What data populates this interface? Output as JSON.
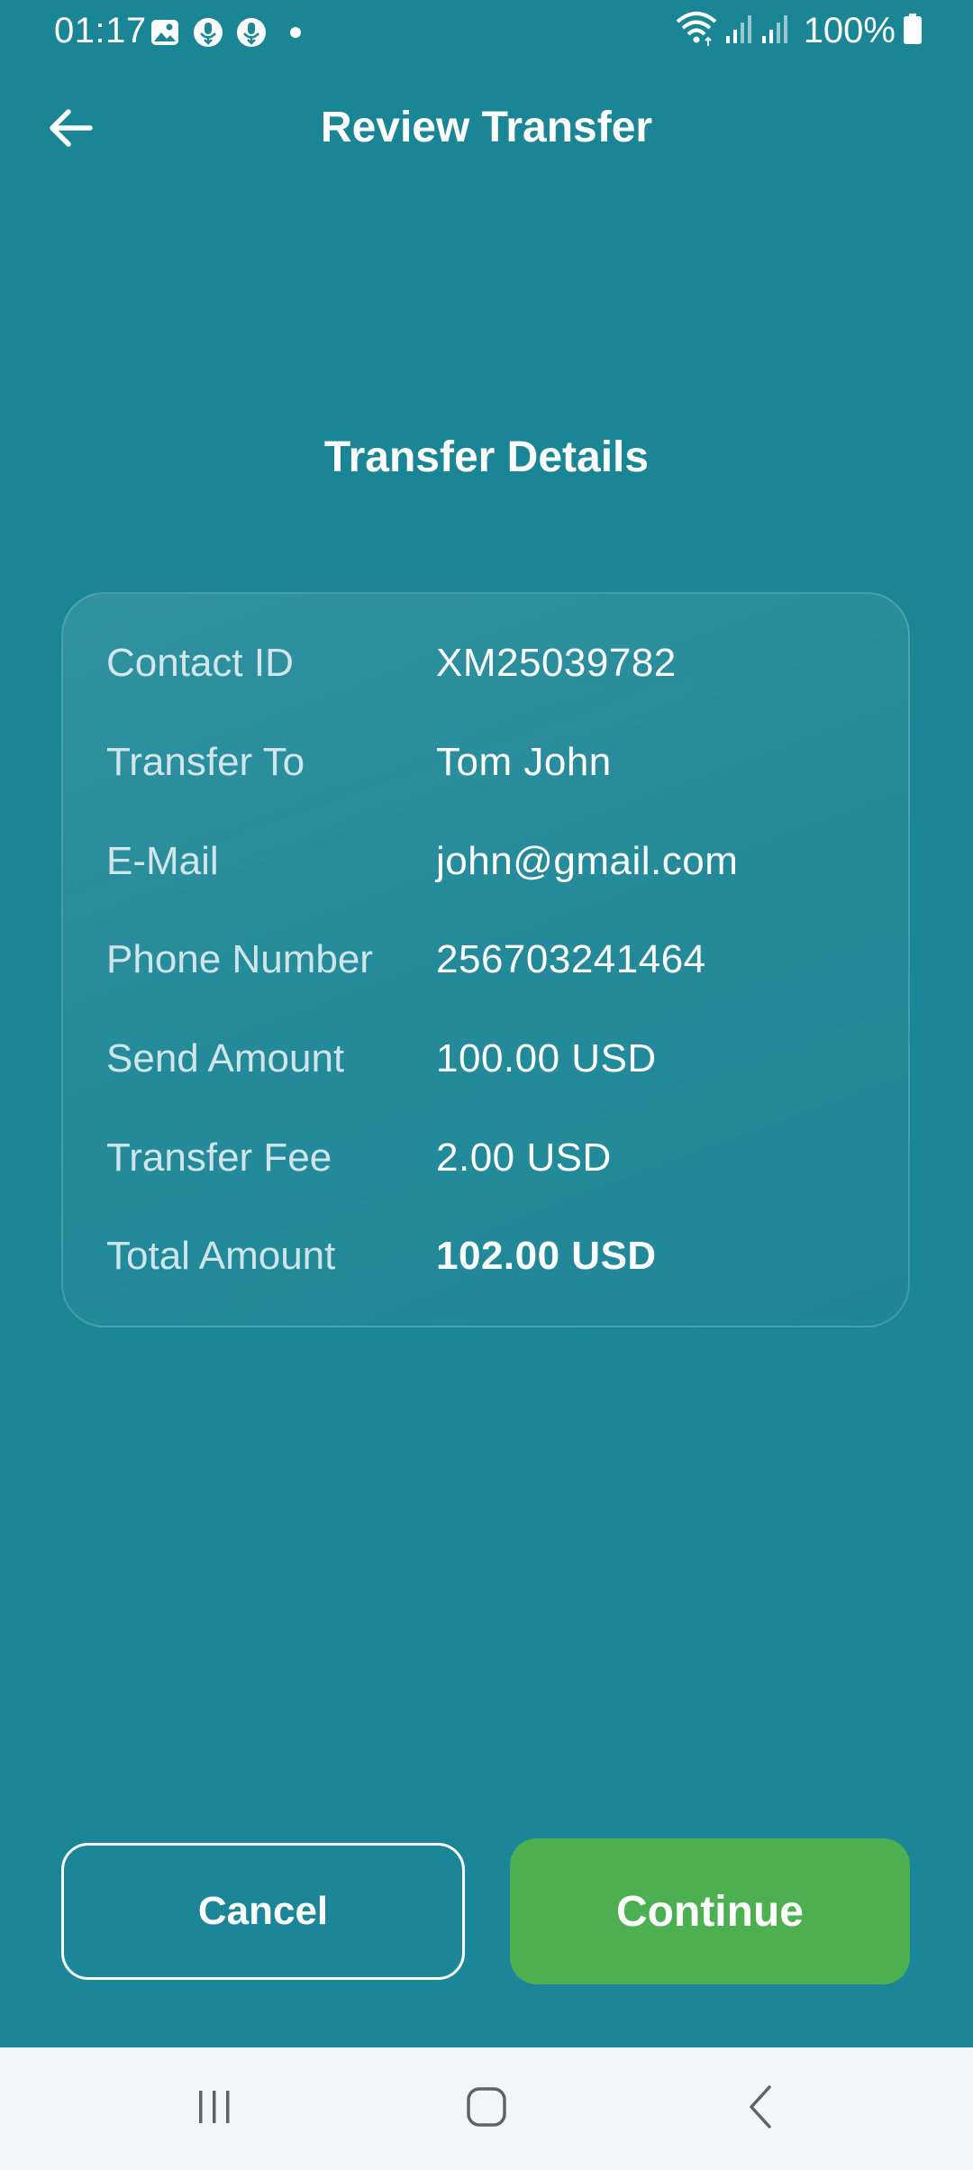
{
  "status_bar": {
    "time": "01:17",
    "battery": "100%",
    "icons": [
      "gallery-icon",
      "mic-download-icon",
      "mic-download-icon",
      "notification-dot",
      "wifi-icon",
      "signal-icon",
      "signal-icon",
      "battery-icon"
    ]
  },
  "header": {
    "title": "Review Transfer",
    "back_icon": "arrow-left-icon"
  },
  "section": {
    "title": "Transfer Details"
  },
  "details": [
    {
      "label": "Contact ID",
      "value": "XM25039782",
      "emphasis": false
    },
    {
      "label": "Transfer To",
      "value": "Tom John",
      "emphasis": false
    },
    {
      "label": "E-Mail",
      "value": "john@gmail.com",
      "emphasis": false
    },
    {
      "label": "Phone Number",
      "value": "256703241464",
      "emphasis": false
    },
    {
      "label": "Send Amount",
      "value": "100.00 USD",
      "emphasis": false
    },
    {
      "label": "Transfer Fee",
      "value": "2.00 USD",
      "emphasis": false
    },
    {
      "label": "Total Amount",
      "value": "102.00 USD",
      "emphasis": true
    }
  ],
  "actions": {
    "cancel_label": "Cancel",
    "continue_label": "Continue"
  },
  "nav_bar": {
    "buttons": [
      "recent-apps-icon",
      "home-icon",
      "back-icon"
    ]
  },
  "colors": {
    "background": "#1a8495",
    "primary_button": "#4caf50",
    "nav_bar": "#f4f5f7"
  }
}
